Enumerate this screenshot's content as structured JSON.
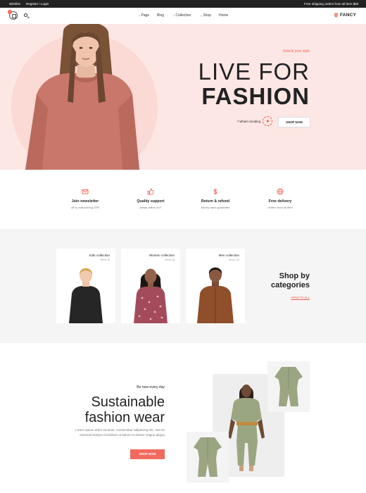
{
  "topbar": {
    "wishlist": "Wishlist",
    "account": "Register / Login",
    "shipping_note": "Free shipping orders from all item $50"
  },
  "header": {
    "cart_count": "0",
    "nav": [
      {
        "label": "Page",
        "has_dropdown": true
      },
      {
        "label": "Blog",
        "has_dropdown": false
      },
      {
        "label": "Collection",
        "has_dropdown": true
      },
      {
        "label": "Shop",
        "has_dropdown": true
      },
      {
        "label": "Home",
        "has_dropdown": false
      }
    ],
    "brand": "FANCY"
  },
  "hero": {
    "tagline": "Unlock your style",
    "title_line1": "LIVE FOR",
    "title_line2": "FASHION",
    "trending_label": "? What's trending",
    "cta": "SHOP NOW"
  },
  "features": [
    {
      "icon": "mail-icon",
      "title": "Join newsletter",
      "desc": "off by subscribing 20%"
    },
    {
      "icon": "thumbs-up-icon",
      "title": "Quality support",
      "desc": "Alway online 24/7"
    },
    {
      "icon": "dollar-icon",
      "title": "Return & refund",
      "desc": "Money back guarantee"
    },
    {
      "icon": "globe-icon",
      "title": "Free delivery",
      "desc": "Orders from all item"
    }
  ],
  "categories": {
    "heading_line1": "Shop by",
    "heading_line2": "categories",
    "view_all": "VIEW TO ALL",
    "items": [
      {
        "title": "Kids collection",
        "count": "Items 18"
      },
      {
        "title": "Women collection",
        "count": "Items 18"
      },
      {
        "title": "Men collection",
        "count": "Items 113"
      }
    ]
  },
  "sustainable": {
    "kicker": "Be new every day",
    "title_line1": "Sustainable",
    "title_line2": "fashion wear",
    "description": "Lorem ipsum dolor sit amet, consectetur adipiscing elit, sed do eiusmod tempor incididunt ut labore et dolore magna aliqua",
    "cta": "SHOP NOW"
  },
  "colors": {
    "accent": "#ef5b4c",
    "hero_bg": "#fde7e4",
    "dark": "#222222",
    "section_gray": "#f5f5f5"
  }
}
